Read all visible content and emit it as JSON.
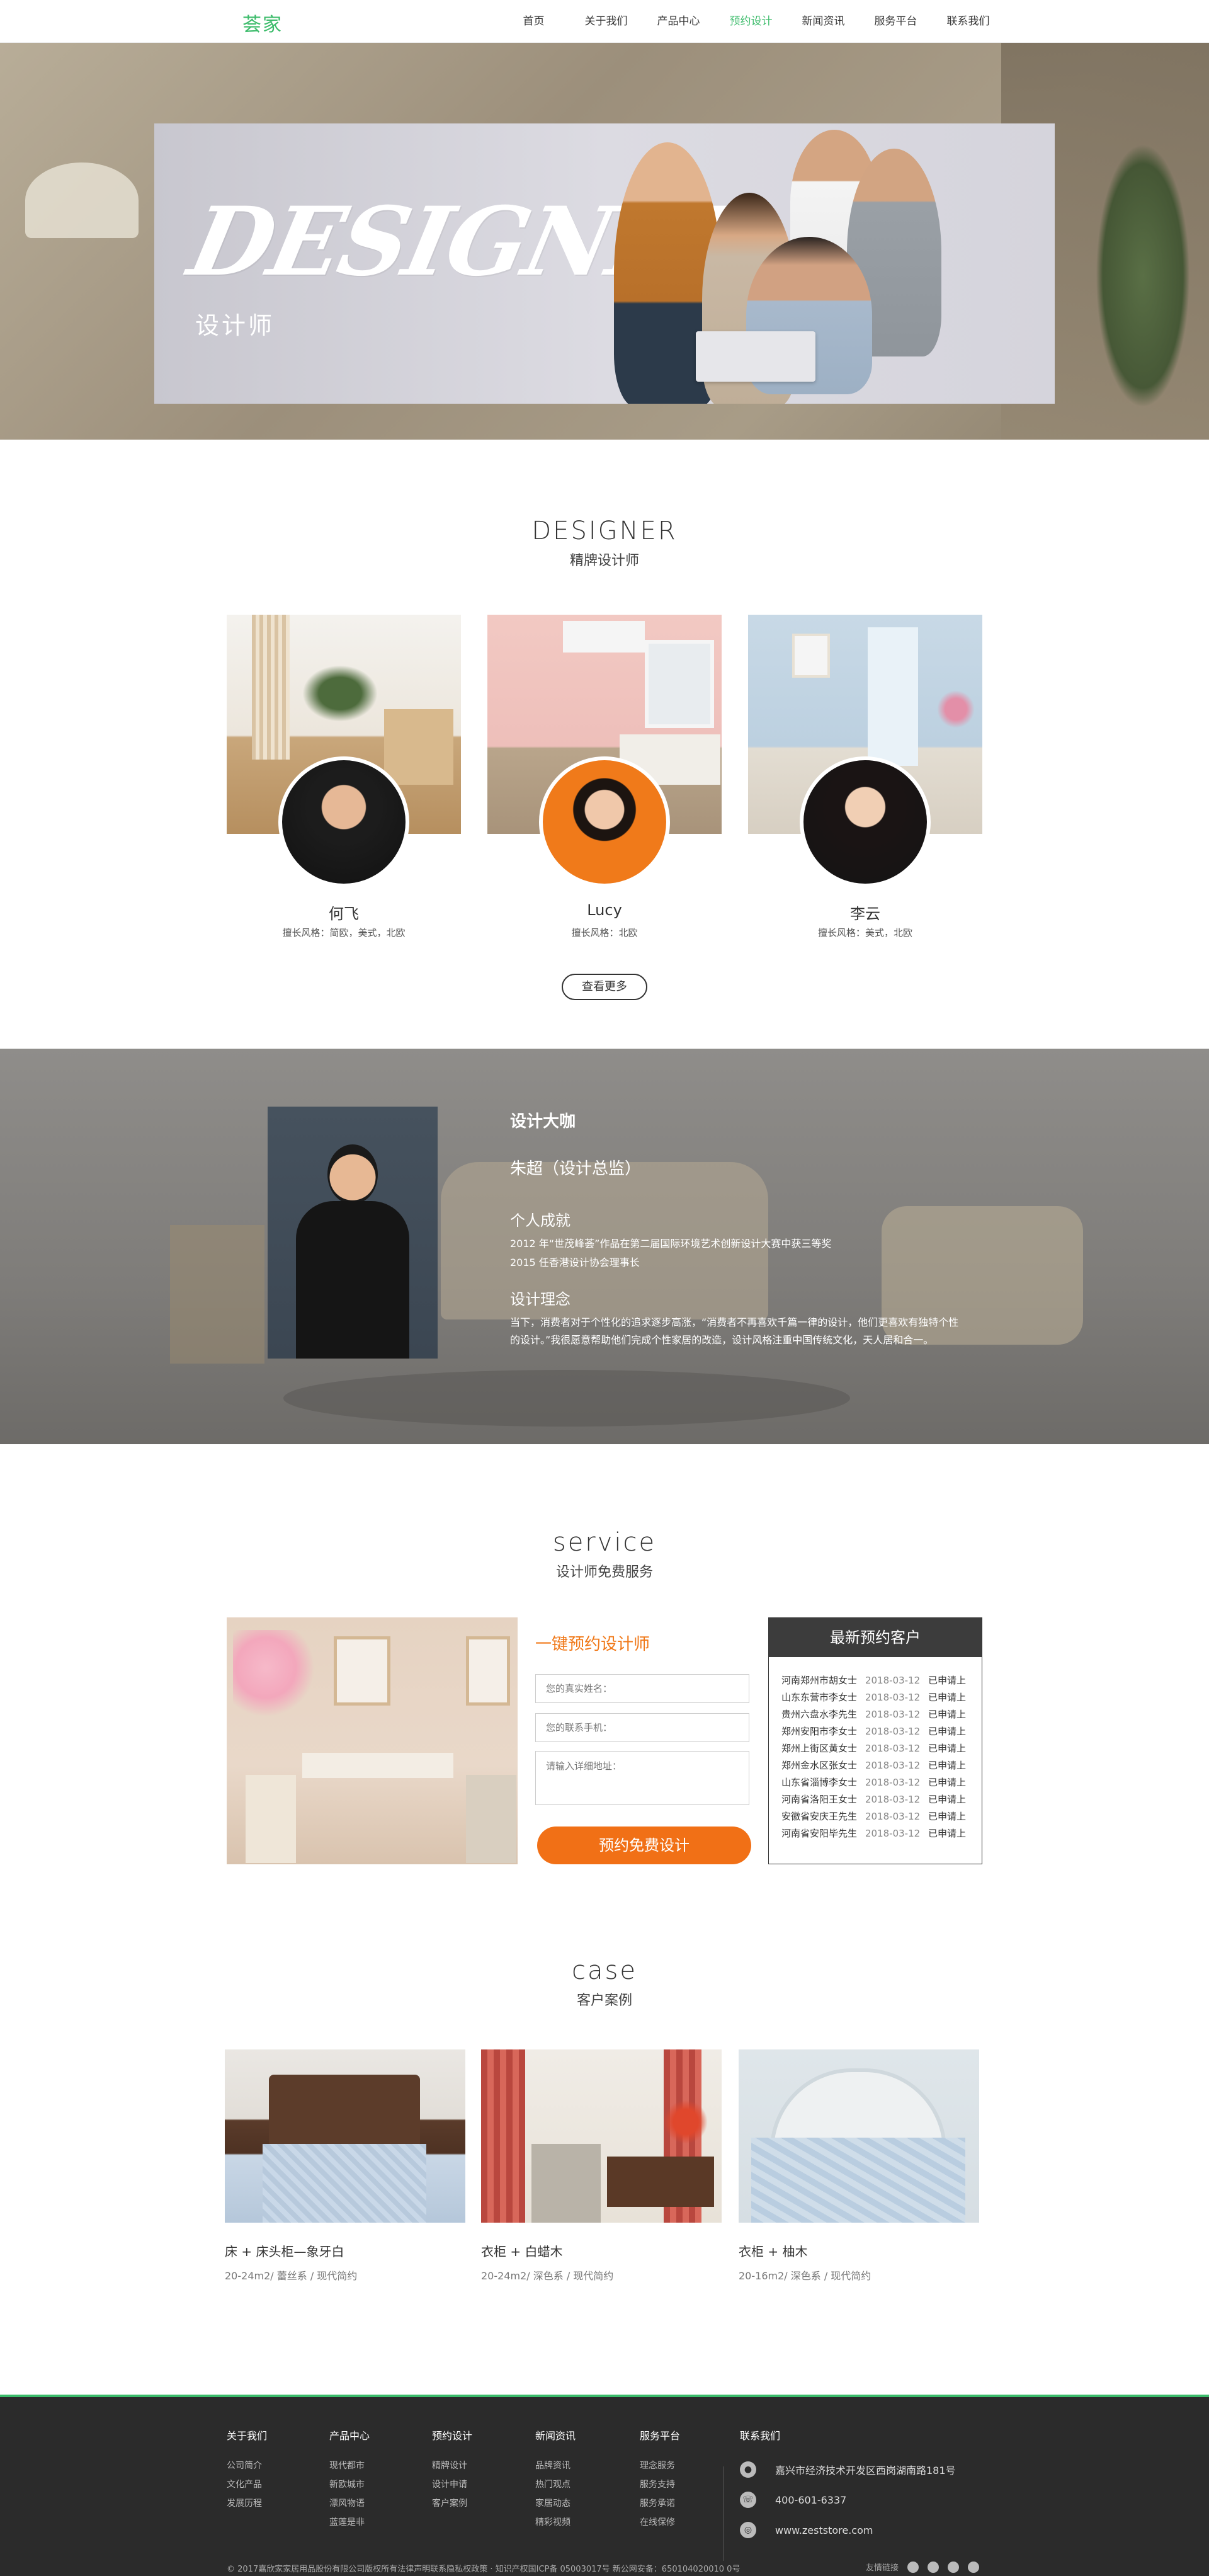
{
  "nav": {
    "logo": "荟家",
    "items": [
      "首页",
      "关于我们",
      "产品中心",
      "预约设计",
      "新闻资讯",
      "服务平台",
      "联系我们"
    ],
    "active_index": 3,
    "accent": "#3bbb6a"
  },
  "banner": {
    "title": "DESIGNER",
    "subtitle": "设计师"
  },
  "designers": {
    "en": "DESIGNER",
    "cn": "精牌设计师",
    "cards": [
      {
        "name": "何飞",
        "style": "擅长风格：简欧，美式，北欧"
      },
      {
        "name": "Lucy",
        "style": "擅长风格：北欧"
      },
      {
        "name": "李云",
        "style": "擅长风格：美式，北欧"
      }
    ],
    "more": "查看更多"
  },
  "master": {
    "title": "设计大咖",
    "name": "朱超（设计总监）",
    "achieve_title": "个人成就",
    "achievements": [
      "2012 年“世茂峰荟”作品在第二届国际环境艺术创新设计大赛中获三等奖",
      "2015 任香港设计协会理事长"
    ],
    "concept_title": "设计理念",
    "concept": "当下，消费者对于个性化的追求逐步高涨，“消费者不再喜欢千篇一律的设计，他们更喜欢有独特个性的设计。”我很愿意帮助他们完成个性家居的改造，设计风格注重中国传统文化，天人居和合一。"
  },
  "service": {
    "en": "service",
    "cn": "设计师免费服务",
    "form_title": "一键预约设计师",
    "name_placeholder": "您的真实姓名：",
    "phone_placeholder": "您的联系手机：",
    "address_placeholder": "请输入详细地址：",
    "submit": "预约免费设计",
    "accent": "#f07818",
    "latest_title": "最新预约客户",
    "latest": [
      {
        "who": "河南郑州市胡女士",
        "when": "2018-03-12",
        "status": "已申请上"
      },
      {
        "who": "山东东营市李女士",
        "when": "2018-03-12",
        "status": "已申请上"
      },
      {
        "who": "贵州六盘水李先生",
        "when": "2018-03-12",
        "status": "已申请上"
      },
      {
        "who": "郑州安阳市李女士",
        "when": "2018-03-12",
        "status": "已申请上"
      },
      {
        "who": "郑州上街区黄女士",
        "when": "2018-03-12",
        "status": "已申请上"
      },
      {
        "who": "郑州金水区张女士",
        "when": "2018-03-12",
        "status": "已申请上"
      },
      {
        "who": "山东省淄博李女士",
        "when": "2018-03-12",
        "status": "已申请上"
      },
      {
        "who": "河南省洛阳王女士",
        "when": "2018-03-12",
        "status": "已申请上"
      },
      {
        "who": "安徽省安庆王先生",
        "when": "2018-03-12",
        "status": "已申请上"
      },
      {
        "who": "河南省安阳毕先生",
        "when": "2018-03-12",
        "status": "已申请上"
      }
    ]
  },
  "cases": {
    "en": "case",
    "cn": "客户案例",
    "items": [
      {
        "title": "床 + 床头柜—象牙白",
        "meta": "20-24m2/ 蕾丝系 / 现代简约"
      },
      {
        "title": "衣柜 + 白蜡木",
        "meta": "20-24m2/ 深色系 / 现代简约"
      },
      {
        "title": "衣柜 + 柚木",
        "meta": "20-16m2/ 深色系 / 现代简约"
      }
    ]
  },
  "footer": {
    "cols": [
      {
        "head": "关于我们",
        "links": [
          "公司简介",
          "文化产品",
          "发展历程"
        ]
      },
      {
        "head": "产品中心",
        "links": [
          "现代都市",
          "新欧城市",
          "漂风物语",
          "蓝莲是非"
        ]
      },
      {
        "head": "预约设计",
        "links": [
          "精牌设计",
          "设计申请",
          "客户案例"
        ]
      },
      {
        "head": "新闻资讯",
        "links": [
          "品牌资讯",
          "热门观点",
          "家居动态",
          "精彩视频"
        ]
      },
      {
        "head": "服务平台",
        "links": [
          "理念服务",
          "服务支持",
          "服务承诺",
          "在线保修"
        ]
      }
    ],
    "contact_head": "联系我们",
    "address": "嘉兴市经济技术开发区西岗湖南路181号",
    "phone": "400-601-6337",
    "site": "www.zeststore.com",
    "copyright": "© 2017嘉欣家家居用品股份有限公司版权所有法律声明联系隐私权政策 · 知识产权国ICP备 05003017号 新公网安备：650104020010 0号",
    "share_label": "友情链接"
  }
}
